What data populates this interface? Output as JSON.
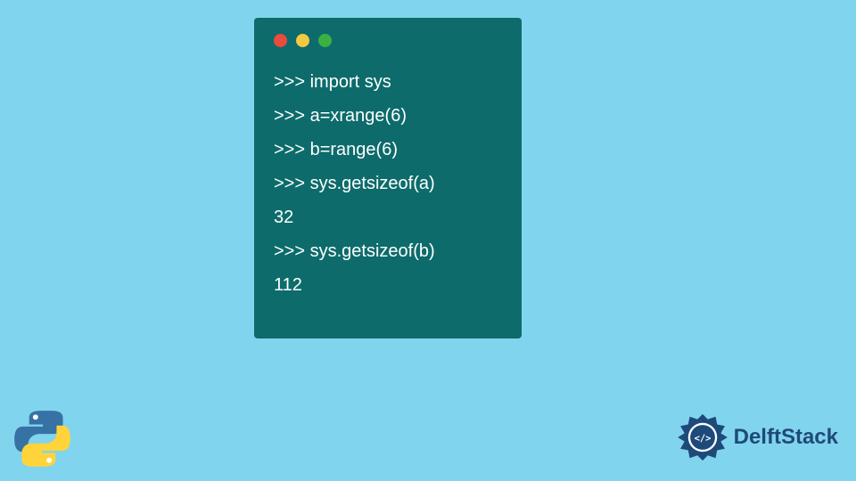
{
  "terminal": {
    "lines": [
      ">>> import sys",
      ">>> a=xrange(6)",
      ">>> b=range(6)",
      ">>> sys.getsizeof(a)",
      "32",
      ">>> sys.getsizeof(b)",
      "112"
    ]
  },
  "branding": {
    "name": "DelftStack"
  },
  "colors": {
    "background": "#81d4ed",
    "terminal": "#0d6b6b",
    "text": "#ffffff",
    "brandText": "#1e4a7a"
  }
}
